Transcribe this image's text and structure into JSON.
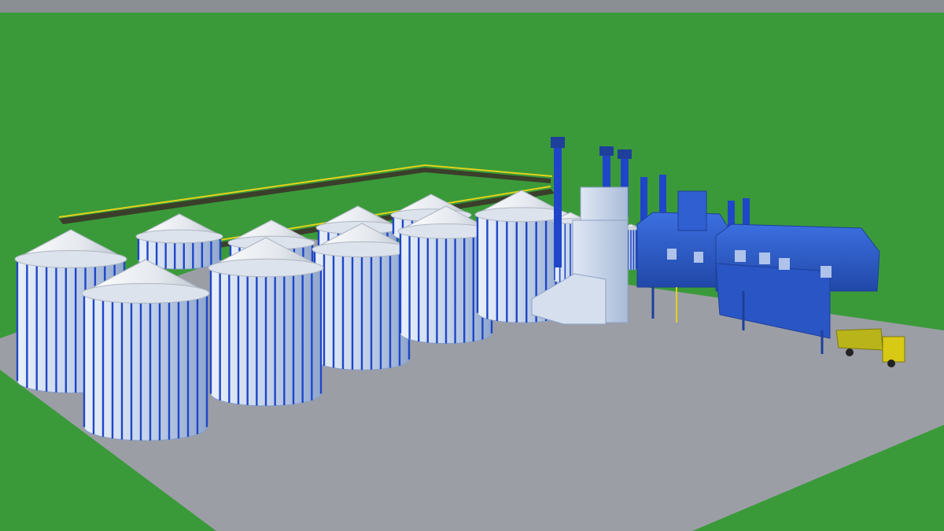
{
  "scene": {
    "colors": {
      "sky_strip": "#8a8f94",
      "grass": "#3a9a3a",
      "pavement": "#9c9ea6",
      "silo_body": "#c9d6e8",
      "silo_rib": "#1f46c8",
      "silo_roof": "#e9edf2",
      "building_blue": "#2f5fd0",
      "building_dark": "#1e3f9a",
      "conveyor_rail": "#e2d21a",
      "dryer_tower": "#c5d4ea",
      "truck_yellow": "#d8c914",
      "truck_body": "#b9b41a"
    },
    "objects": {
      "silo_count": 12,
      "has_conveyor_gallery": true,
      "has_dryer_tower": true,
      "has_receiving_building": true,
      "has_truck": true
    }
  }
}
